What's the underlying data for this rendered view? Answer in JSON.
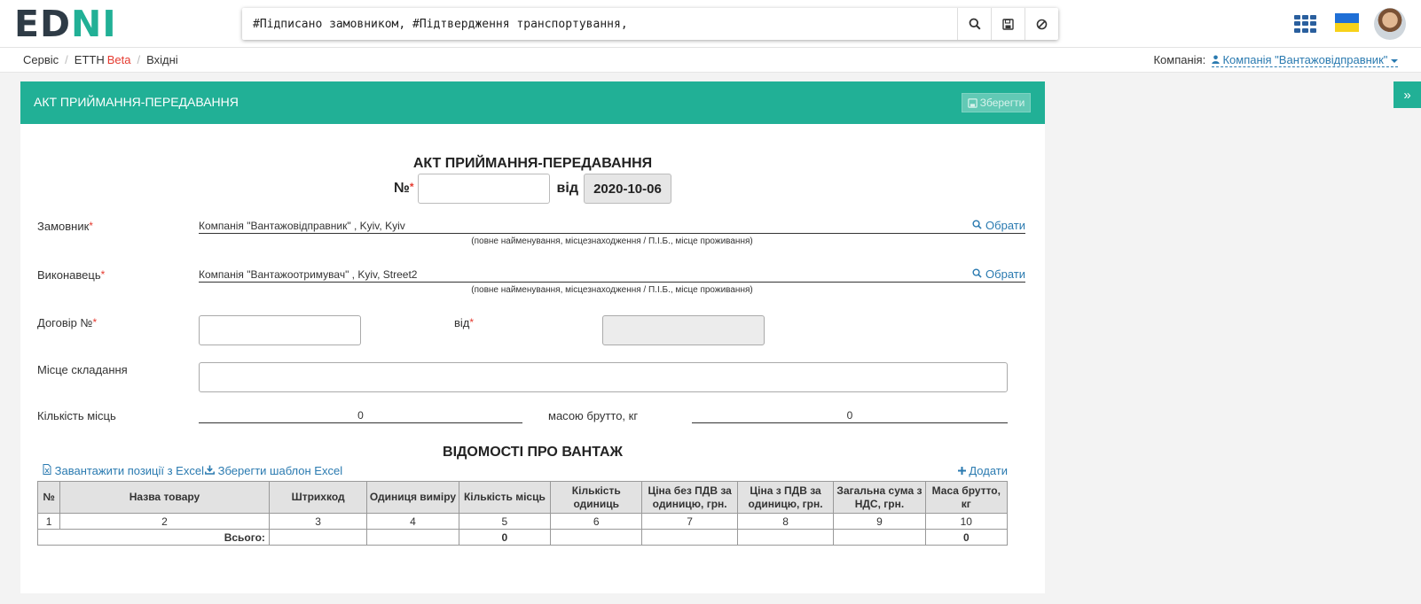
{
  "header": {
    "logo_left": "ED",
    "logo_right": "NI",
    "search_value": "#Підписано замовником, #Підтвердження транспортування,",
    "icons": [
      "search-icon",
      "save-icon",
      "ban-icon",
      "apps-grid-icon",
      "ukraine-flag-icon",
      "avatar"
    ]
  },
  "breadcrumb": {
    "items": [
      "Сервіс",
      "ЕТТН",
      "Вхідні"
    ],
    "beta": "Beta"
  },
  "company": {
    "label": "Компанія:",
    "value": "Компанія \"Вантажовідправник\""
  },
  "card": {
    "title": "АКТ ПРИЙМАННЯ-ПЕРЕДАВАННЯ",
    "save_label": "Зберегти"
  },
  "form": {
    "doc_title": "АКТ ПРИЙМАННЯ-ПЕРЕДАВАННЯ",
    "number_label": "№",
    "number_value": "",
    "from_label": "від",
    "date": "2020-10-06",
    "customer_label": "Замовник",
    "customer_value": "Компанія \"Вантажовідправник\" , Kyiv, Kyiv",
    "choose_label": "Обрати",
    "hint": "(повне найменування, місцезнаходження / П.І.Б., місце проживання)",
    "contractor_label": "Виконавець",
    "contractor_value": "Компанія \"Вантажоотримувач\" , Kyiv, Street2",
    "contract_label": "Договір №",
    "contract_value": "",
    "contract_from_label": "від",
    "place_label": "Місце складання",
    "place_value": "",
    "places_count_label": "Кількість місць",
    "places_count_value": "0",
    "gross_label": "масою брутто, кг",
    "gross_value": "0"
  },
  "cargo": {
    "title": "ВІДОМОСТІ ПРО ВАНТАЖ",
    "load_excel": "Завантажити позиції з Excel",
    "save_template": "Зберегти шаблон Excel",
    "add": "Додати",
    "columns": [
      "№",
      "Назва товару",
      "Штрихкод",
      "Одиниця виміру",
      "Кількість місць",
      "Кількість одиниць",
      "Ціна без ПДВ за одиницю, грн.",
      "Ціна з ПДВ за одиницю, грн.",
      "Загальна сума з НДС, грн.",
      "Маса брутто, кг"
    ],
    "index_row": [
      "1",
      "2",
      "3",
      "4",
      "5",
      "6",
      "7",
      "8",
      "9",
      "10"
    ],
    "total_label": "Всього:",
    "total_places": "0",
    "total_mass": "0"
  },
  "colors": {
    "brand_green": "#21b096",
    "brand_dark": "#2e3b46",
    "link_blue": "#2a7ab0",
    "required_red": "#e53a2f"
  }
}
